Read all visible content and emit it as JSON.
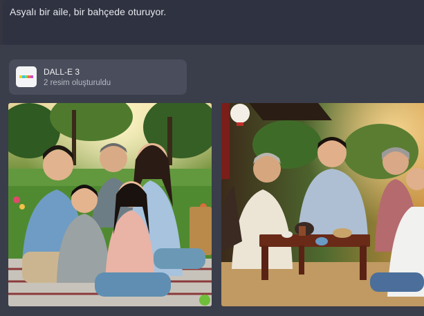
{
  "user_message": "Asyalı bir aile, bir bahçede oturuyor.",
  "tool": {
    "title": "DALL-E 3",
    "subtitle": "2 resim oluşturuldu",
    "icon": "dalle-logo-icon"
  },
  "images": [
    {
      "icon": "generated-image-family-picnic"
    },
    {
      "icon": "generated-image-family-tea"
    }
  ],
  "colors": {
    "background": "#343541",
    "card": "#4a4d5b",
    "text": "#e8e9ef",
    "logo_strip": [
      "#f5d000",
      "#33c3f0",
      "#8ed44b",
      "#ff6a3d",
      "#c24de0"
    ]
  }
}
